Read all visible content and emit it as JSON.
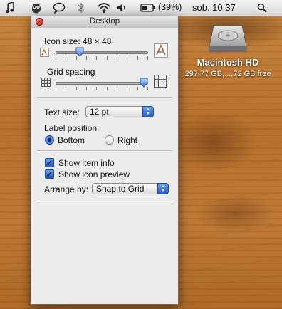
{
  "menubar": {
    "battery_percent": "(39%)",
    "clock": "sob. 10:37",
    "icons": [
      "music-note-icon",
      "owl-icon",
      "speech-bubble-icon",
      "bluetooth-icon",
      "wifi-icon",
      "volume-icon",
      "battery-icon",
      "spotlight-icon"
    ]
  },
  "desktop": {
    "drive_name": "Macintosh HD",
    "drive_info": "297,77 GB,...,72 GB free"
  },
  "panel": {
    "title": "Desktop",
    "icon_size_label": "Icon size: 48 × 48",
    "icon_size_slider_fraction": 0.24,
    "grid_spacing_label": "Grid spacing",
    "grid_spacing_slider_fraction": 1.0,
    "text_size_label": "Text size:",
    "text_size_value": "12 pt",
    "label_position_label": "Label position:",
    "label_position_options": [
      "Bottom",
      "Right"
    ],
    "label_position_selected": "Bottom",
    "show_item_info_label": "Show item info",
    "show_item_info_checked": true,
    "show_icon_preview_label": "Show icon preview",
    "show_icon_preview_checked": true,
    "arrange_by_label": "Arrange by:",
    "arrange_by_value": "Snap to Grid"
  }
}
